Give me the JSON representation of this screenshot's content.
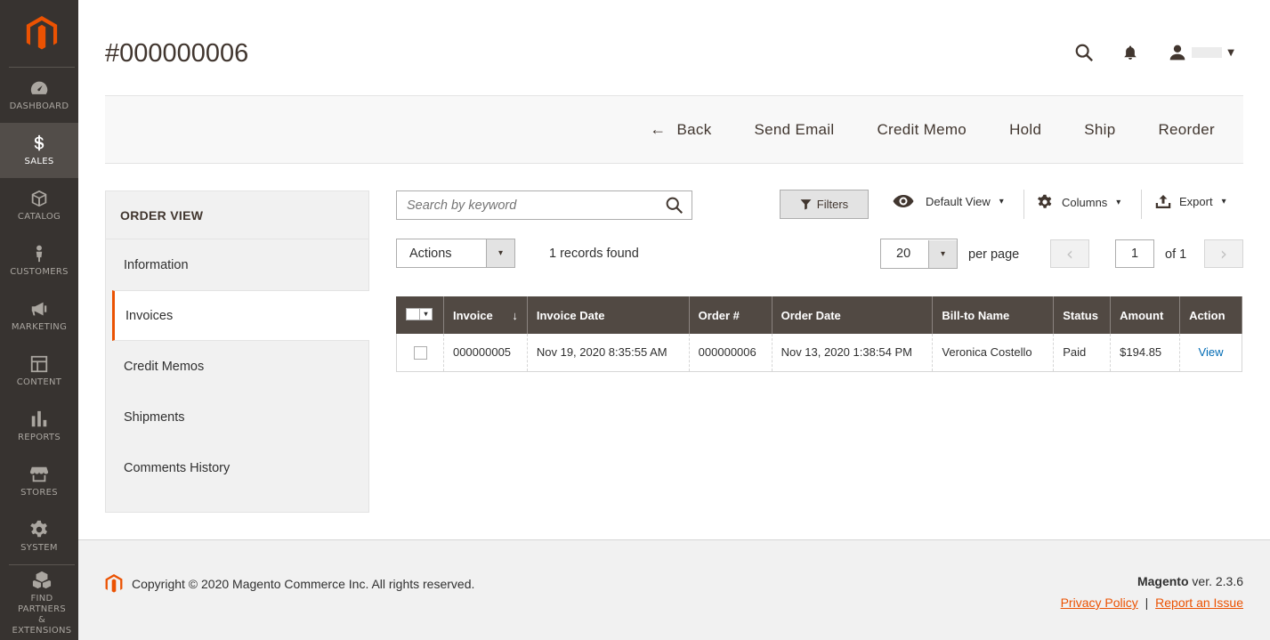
{
  "sidebar": {
    "items": [
      {
        "label": "DASHBOARD",
        "icon": "dashboard-icon"
      },
      {
        "label": "SALES",
        "icon": "dollar-icon"
      },
      {
        "label": "CATALOG",
        "icon": "box-icon"
      },
      {
        "label": "CUSTOMERS",
        "icon": "person-icon"
      },
      {
        "label": "MARKETING",
        "icon": "megaphone-icon"
      },
      {
        "label": "CONTENT",
        "icon": "layout-icon"
      },
      {
        "label": "REPORTS",
        "icon": "bar-chart-icon"
      },
      {
        "label": "STORES",
        "icon": "store-icon"
      },
      {
        "label": "SYSTEM",
        "icon": "gear-icon"
      },
      {
        "label_line1": "FIND PARTNERS",
        "label_line2": "& EXTENSIONS",
        "icon": "boxes-icon"
      }
    ],
    "active": "SALES"
  },
  "page": {
    "title": "#000000006"
  },
  "toolbar": {
    "back_arrow": "←",
    "back": "Back",
    "send_email": "Send Email",
    "credit_memo": "Credit Memo",
    "hold": "Hold",
    "ship": "Ship",
    "reorder": "Reorder"
  },
  "order_view": {
    "title": "ORDER VIEW",
    "tabs": [
      "Information",
      "Invoices",
      "Credit Memos",
      "Shipments",
      "Comments History"
    ],
    "active_tab": "Invoices"
  },
  "grid": {
    "search_placeholder": "Search by keyword",
    "filters": "Filters",
    "default_view": "Default View",
    "columns": "Columns",
    "export": "Export",
    "caret": "▾",
    "actions": "Actions",
    "records_found": "1 records found",
    "per_page_value": "20",
    "per_page_label": "per page",
    "page_prev": "‹",
    "page_next": "›",
    "current_page": "1",
    "of_pages": "of 1",
    "sort_arrow": "↓",
    "headers": [
      "Invoice",
      "Invoice Date",
      "Order #",
      "Order Date",
      "Bill-to Name",
      "Status",
      "Amount",
      "Action"
    ],
    "rows": [
      {
        "invoice": "000000005",
        "invoice_date": "Nov 19, 2020 8:35:55 AM",
        "order": "000000006",
        "order_date": "Nov 13, 2020 1:38:54 PM",
        "bill_to": "Veronica Costello",
        "status": "Paid",
        "amount": "$194.85",
        "action": "View"
      }
    ]
  },
  "footer": {
    "copyright": "Copyright © 2020 Magento Commerce Inc. All rights reserved.",
    "brand": "Magento",
    "version": " ver. 2.3.6",
    "privacy": "Privacy Policy",
    "separator": "|",
    "report": "Report an Issue"
  },
  "colors": {
    "sidebar_bg": "#373330",
    "accent": "#eb5202",
    "table_header": "#514943",
    "link": "#006bb4"
  }
}
